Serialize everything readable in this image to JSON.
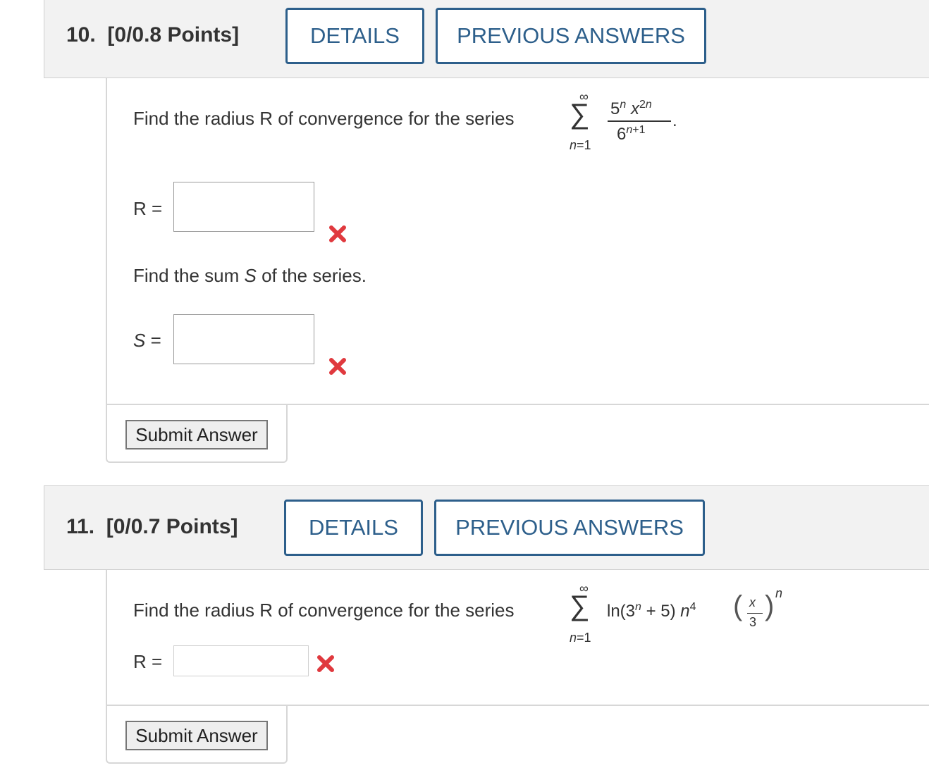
{
  "q10": {
    "number": "10.",
    "points": "[0/0.8 Points]",
    "details_label": "DETAILS",
    "previous_answers_label": "PREVIOUS ANSWERS",
    "prompt1": "Find the radius R of convergence for the series",
    "series": {
      "upper": "∞",
      "lower": "n=1",
      "numerator": "5n x2n",
      "denominator": "6n+1"
    },
    "r_label": "R =",
    "r_value": "",
    "prompt2_pre": "Find the sum ",
    "prompt2_var": "S",
    "prompt2_post": " of the series.",
    "s_label": "S",
    "s_eq": " =",
    "s_value": "",
    "submit_label": "Submit Answer"
  },
  "q11": {
    "number": "11.",
    "points": "[0/0.7 Points]",
    "details_label": "DETAILS",
    "previous_answers_label": "PREVIOUS ANSWERS",
    "prompt1": "Find the radius R of convergence for the series",
    "series": {
      "upper": "∞",
      "lower": "n=1",
      "term": "ln(3n + 5) n4 (x/3)n"
    },
    "r_label": "R =",
    "r_value": "",
    "submit_label": "Submit Answer"
  },
  "colors": {
    "accent": "#2d5f8b",
    "header_bg": "#f2f2f2",
    "incorrect": "#e0393e"
  },
  "icons": {
    "incorrect": "x-mark-icon"
  }
}
